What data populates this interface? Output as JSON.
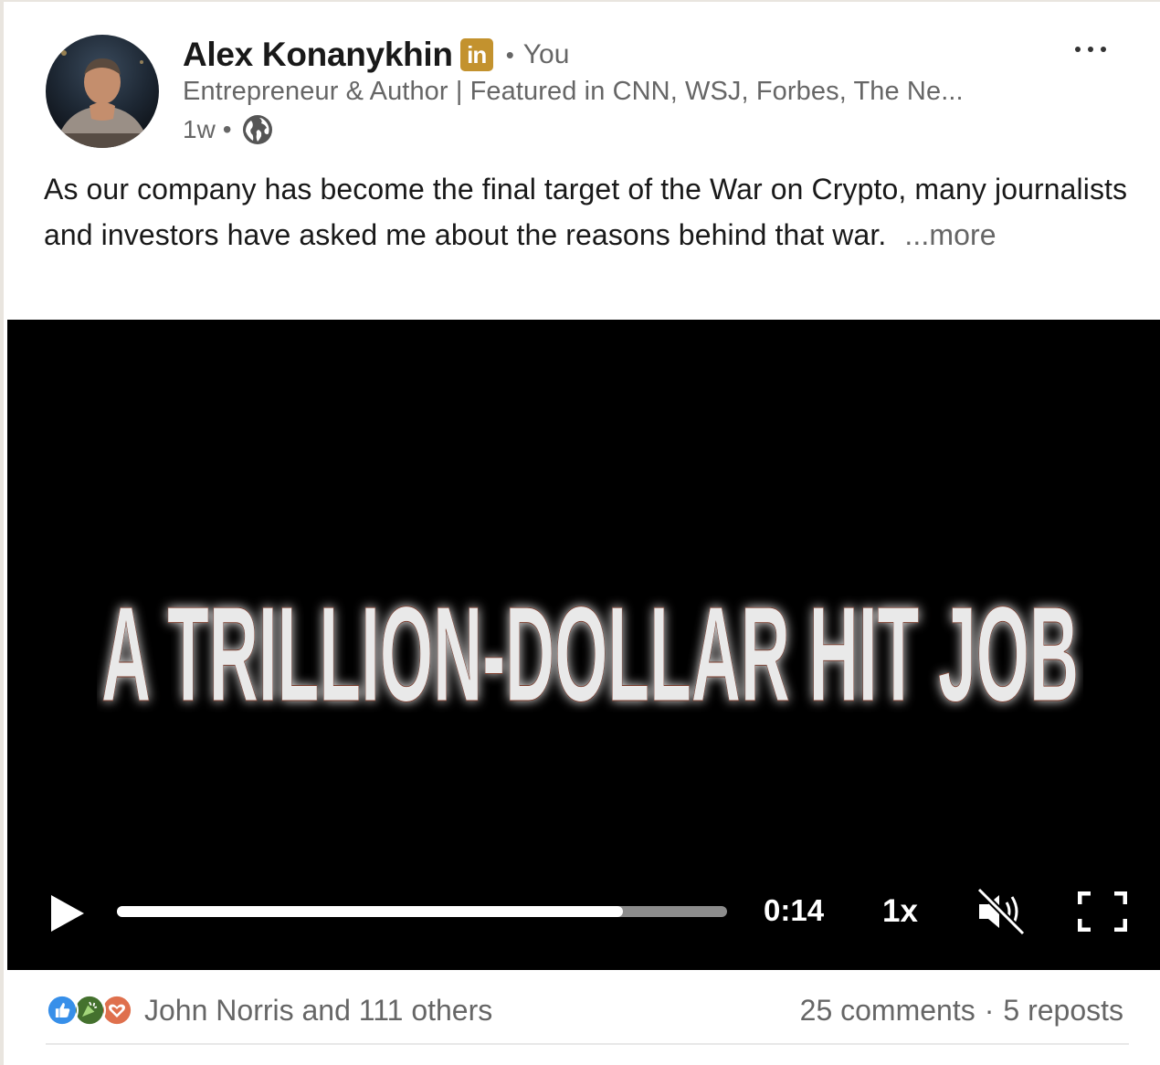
{
  "author": {
    "name": "Alex Konanykhin",
    "badge": "in",
    "relation": "You",
    "headline": "Entrepreneur & Author | Featured in CNN, WSJ, Forbes, The Ne...",
    "time": "1w",
    "visibility_icon": "globe-icon"
  },
  "post": {
    "text": "As our company has become the final target of the War on Crypto, many journalists and investors have asked me about the reasons behind that war.",
    "see_more": "...more"
  },
  "video": {
    "title": "A TRILLION-DOLLAR HIT JOB",
    "time": "0:14",
    "speed": "1x",
    "progress": 0.83,
    "muted": true,
    "icons": [
      "play-icon",
      "mute-icon",
      "fullscreen-icon"
    ]
  },
  "social": {
    "reactions_label": "John Norris and 111 others",
    "reaction_icons": [
      "like-icon",
      "celebrate-icon",
      "love-icon"
    ],
    "comments": "25 comments",
    "reposts": "5 reposts"
  },
  "colors": {
    "badge": "#c3922e",
    "secondary_text": "#666666",
    "video_bg": "#000000"
  }
}
